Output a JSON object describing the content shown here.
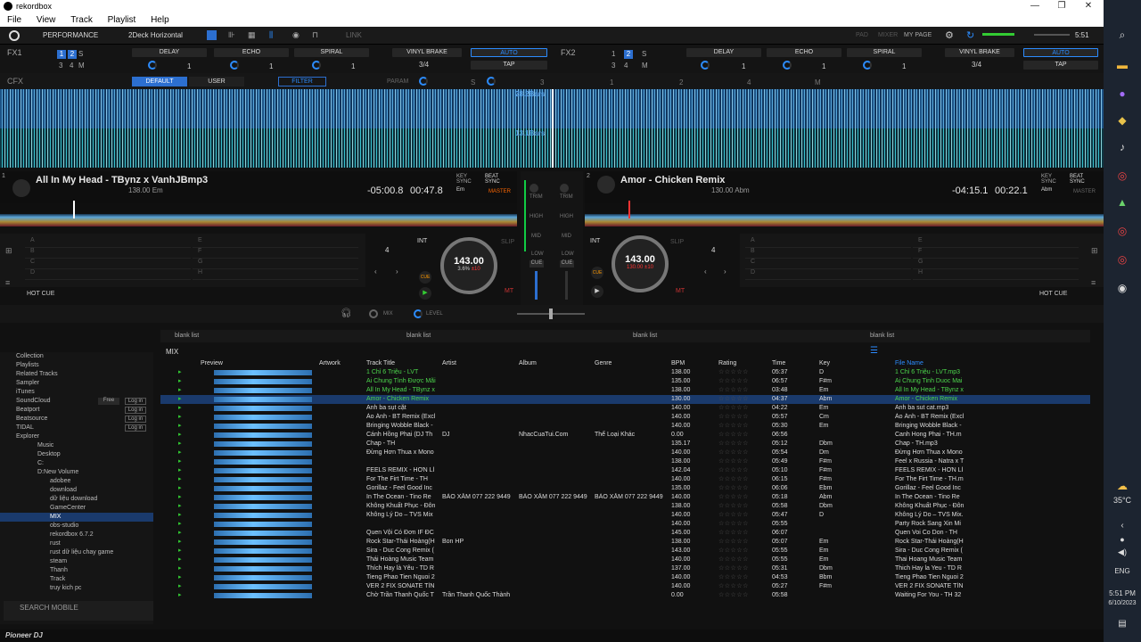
{
  "window": {
    "title": "rekordbox",
    "min": "—",
    "max": "❐",
    "close": "✕"
  },
  "menu": [
    "File",
    "View",
    "Track",
    "Playlist",
    "Help"
  ],
  "top": {
    "mode": "PERFORMANCE",
    "layout": "2Deck Horizontal",
    "link": "LINK",
    "pad": "PAD",
    "mixer": "MIXER",
    "mypage": "MY PAGE",
    "clock": "5:51"
  },
  "fx": {
    "fx1": "FX1",
    "fx2": "FX2",
    "slots1": [
      "DELAY",
      "ECHO",
      "SPIRAL",
      "VINYL BRAKE"
    ],
    "slots2": [
      "DELAY",
      "ECHO",
      "SPIRAL",
      "VINYL BRAKE"
    ],
    "beat": "1",
    "frac": "3/4",
    "auto": "AUTO",
    "tap": "TAP",
    "btns": [
      "1",
      "2",
      "S",
      "3",
      "4",
      "M"
    ]
  },
  "cfx": {
    "label": "CFX",
    "default": "DEFAULT",
    "user": "USER",
    "filter": "FILTER",
    "param": "PARAM",
    "s": "S",
    "m": "M",
    "n1": "1",
    "n2": "2",
    "n3": "3",
    "n4": "4"
  },
  "wave": {
    "bars1": "28.2Bars",
    "bars2": "13.1Bars"
  },
  "deck1": {
    "num": "1",
    "title": "All In My Head - TBynz x VanhJBmp3",
    "sub": "138.00 Em",
    "remain": "-05:00.8",
    "elapsed": "00:47.8",
    "keysync": "KEY SYNC",
    "key": "Em",
    "beatsync": "BEAT SYNC",
    "master": "MASTER",
    "bpm": "143.00",
    "pitch": "3.6%",
    "range": "±10",
    "quant": "4",
    "int": "INT",
    "slip": "SLIP",
    "cue": "CUE",
    "hotcue": "HOT CUE",
    "mt": "MT"
  },
  "deck2": {
    "num": "2",
    "title": "Amor - Chicken Remix",
    "sub": "130.00 Abm",
    "remain": "-04:15.1",
    "elapsed": "00:22.1",
    "keysync": "KEY SYNC",
    "key": "Abm",
    "beatsync": "BEAT SYNC",
    "master": "MASTER",
    "bpm": "143.00",
    "pitch": "130.00",
    "range": "±10",
    "quant": "4",
    "int": "INT",
    "slip": "SLIP",
    "cue": "CUE",
    "hotcue": "HOT CUE",
    "mt": "MT"
  },
  "mixer": {
    "trim": "TRIM",
    "high": "HIGH",
    "mid": "MID",
    "low": "LOW",
    "cue": "CUE",
    "mix": "MIX",
    "level": "LEVEL"
  },
  "pads": {
    "left": [
      "A",
      "B",
      "C",
      "D"
    ],
    "right": [
      "E",
      "F",
      "G",
      "H"
    ]
  },
  "browser": {
    "tabs": [
      "blank list",
      "blank list",
      "blank list",
      "blank list"
    ],
    "current": "MIX",
    "tree": [
      "Collection",
      "Playlists",
      "Related Tracks",
      "Sampler",
      "iTunes",
      "SoundCloud",
      "Beatport",
      "Beatsource",
      "TIDAL",
      "Explorer",
      "Music",
      "Desktop",
      "C:",
      "D:New Volume",
      "adobee",
      "download",
      "dữ liệu download",
      "GameCenter",
      "MIX",
      "obs-studio",
      "rekordbox 6.7.2",
      "rust",
      "rust dữ liệu chay game",
      "steam",
      "Thanh",
      "Track",
      "truy kich pc"
    ],
    "free": "Free",
    "login": "Log in",
    "search": "SEARCH MOBILE",
    "cols": [
      "Preview",
      "Artwork",
      "Track Title",
      "Artist",
      "Album",
      "Genre",
      "BPM",
      "Rating",
      "Time",
      "Key",
      "File Name"
    ],
    "rows": [
      [
        "1 Chỉ 6 Triệu - LVT",
        "",
        "",
        "",
        "138.00",
        "05:37",
        "D",
        "1 Chỉ 6 Triệu - LVT.mp3",
        "g"
      ],
      [
        "Ai Chung Tình Được Mãi",
        "",
        "",
        "",
        "135.00",
        "06:57",
        "F#m",
        "Ai Chung Tinh Duoc Mai",
        "g"
      ],
      [
        "All In My Head - TBynz x",
        "",
        "",
        "",
        "138.00",
        "03:48",
        "Em",
        "All In My Head - TBynz x",
        "g"
      ],
      [
        "Amor - Chicken Remix",
        "",
        "",
        "",
        "130.00",
        "04:37",
        "Abm",
        "Amor - Chicken Remix",
        "s"
      ],
      [
        "Anh ba sụt cặt",
        "",
        "",
        "",
        "140.00",
        "04:22",
        "Em",
        "Anh ba sut cat.mp3",
        ""
      ],
      [
        "Áo Ánh - BT Remix (Excl",
        "",
        "",
        "",
        "140.00",
        "05:57",
        "Cm",
        "Áo Ánh - BT Remix (Excl",
        ""
      ],
      [
        "Bringing Wobble Black -",
        "",
        "",
        "",
        "140.00",
        "05:30",
        "Em",
        "Bringing Wobble Black -",
        ""
      ],
      [
        "Cánh Hồng Phai (DJ Th",
        "DJ",
        "NhacCuaTui.Com",
        "Thể Loại Khác",
        "0.00",
        "06:56",
        "",
        "Canh Hong Phai - TH.m",
        ""
      ],
      [
        "Chap - TH",
        "",
        "",
        "",
        "135.17",
        "05:12",
        "Dbm",
        "Chap - TH.mp3",
        ""
      ],
      [
        "Đừng Hơn Thua x Mono",
        "",
        "",
        "",
        "140.00",
        "05:54",
        "Dm",
        "Đừng Hơn Thua x Mono",
        ""
      ],
      [
        "",
        "",
        "",
        "",
        "138.00",
        "05:49",
        "F#m",
        "Feel x Russia - Natra x T",
        ""
      ],
      [
        "FEELS REMIX - HƠN LÌ",
        "",
        "",
        "",
        "142.04",
        "05:10",
        "F#m",
        "FEELS REMIX - HƠN LÌ",
        ""
      ],
      [
        "For The Firt Time - TH",
        "",
        "",
        "",
        "140.00",
        "06:15",
        "F#m",
        "For The Firt Time - TH.m",
        ""
      ],
      [
        "Gorillaz - Feel Good Inc",
        "",
        "",
        "",
        "135.00",
        "06:06",
        "Ebm",
        "Gorillaz - Feel Good Inc",
        ""
      ],
      [
        "In The Ocean - Tino Re",
        "BẢO XĂM 077 222 9449",
        "BẢO XĂM 077 222 9449",
        "BẢO XĂM 077 222 9449",
        "140.00",
        "05:18",
        "Abm",
        "In The Ocean - Tino Re",
        ""
      ],
      [
        "Không Khuất Phục - Đôn",
        "",
        "",
        "",
        "138.00",
        "05:58",
        "Dbm",
        "Không Khuất Phục - Đôn",
        ""
      ],
      [
        "Không Lý Do – TVS Mix",
        "",
        "",
        "",
        "140.00",
        "05:47",
        "D",
        "Không Lý Do – TVS Mix.",
        ""
      ],
      [
        "",
        "",
        "",
        "",
        "140.00",
        "05:55",
        "",
        "Party Rock Sang Xin Mi",
        ""
      ],
      [
        "Quen Vội Có Đơn IF ĐC",
        "",
        "",
        "",
        "145.00",
        "06:07",
        "",
        "Quen Voi Co Don - TH",
        ""
      ],
      [
        "Rock Star-Thái Hoàng(H",
        "Bon HP",
        "",
        "",
        "138.00",
        "05:07",
        "Em",
        "Rock Star-Thái Hoàng(H",
        ""
      ],
      [
        "Sira - Duc Cong Remix (",
        "",
        "",
        "",
        "143.00",
        "05:55",
        "Em",
        "Sira - Duc Cong Remix (",
        ""
      ],
      [
        "Thái Hoàng Music Team",
        "",
        "",
        "",
        "140.00",
        "05:55",
        "Em",
        "Thai Hoang Music Team",
        ""
      ],
      [
        "Thích Hay là Yêu - TD R",
        "",
        "",
        "",
        "137.00",
        "05:31",
        "Dbm",
        "Thich Hay la Yeu - TD R",
        ""
      ],
      [
        "Tieng Phao Tien Nguoi 2",
        "",
        "",
        "",
        "140.00",
        "04:53",
        "Bbm",
        "Tieng Phao Tien Nguoi 2",
        ""
      ],
      [
        "VER 2 FIX SONATE TÍN",
        "",
        "",
        "",
        "140.00",
        "05:27",
        "F#m",
        "VER 2 FIX SONATE TÍN",
        ""
      ],
      [
        "Chờ Trần Thanh Quốc T",
        "Trần Thanh Quốc Thành",
        "",
        "",
        "0.00",
        "05:58",
        "",
        "Waiting For You - TH 32",
        ""
      ]
    ]
  },
  "footer": {
    "brand": "Pioneer DJ"
  },
  "taskbar": {
    "temp": "35°C",
    "lang": "ENG",
    "time": "5:51 PM",
    "date": "6/10/2023"
  }
}
